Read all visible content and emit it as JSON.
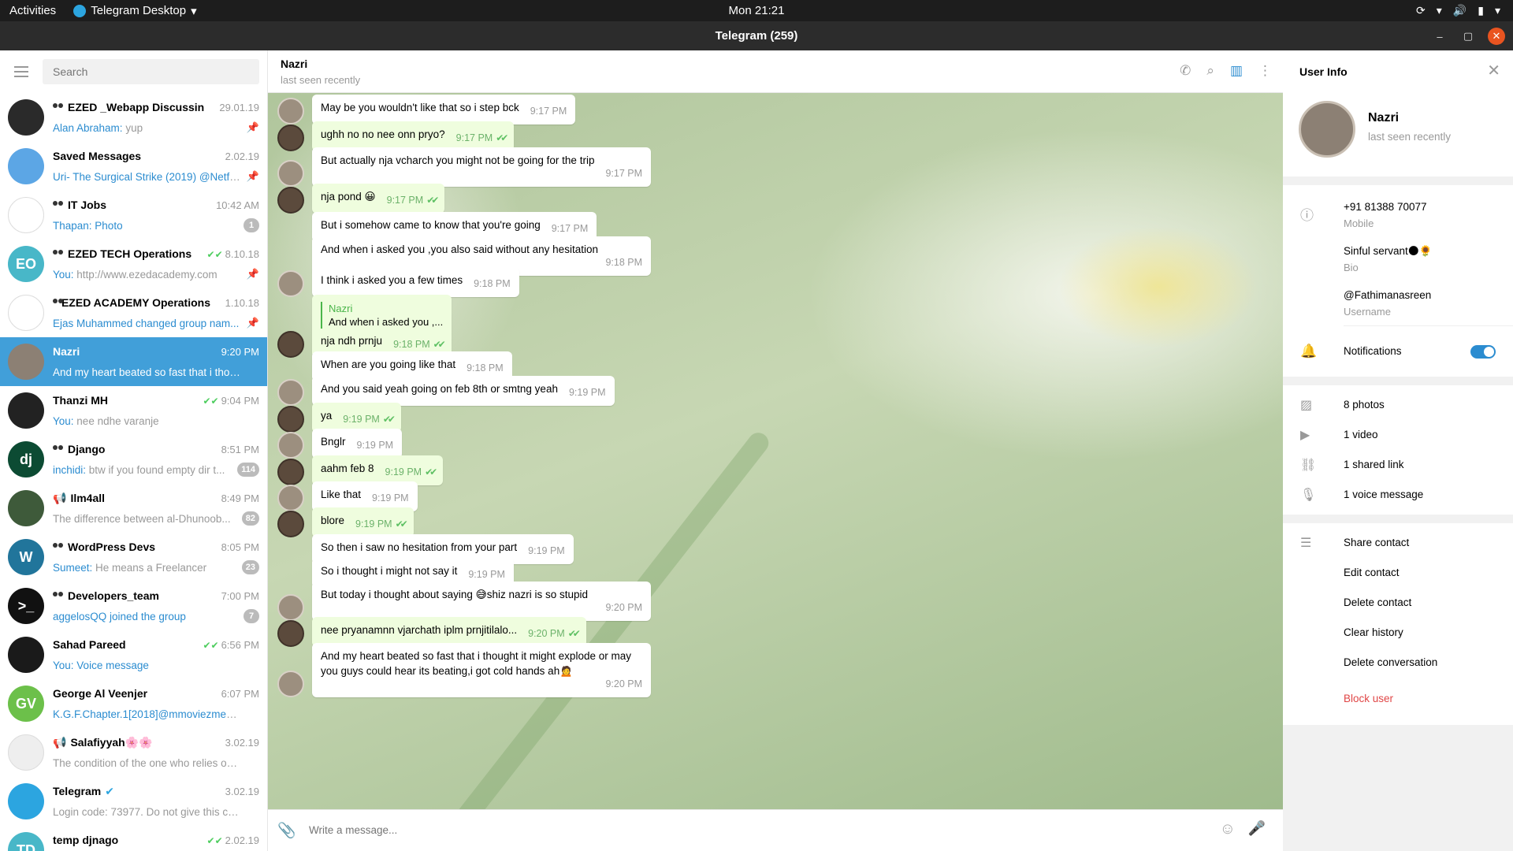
{
  "topbar": {
    "activities": "Activities",
    "app": "Telegram Desktop",
    "clock": "Mon 21:21"
  },
  "window": {
    "title": "Telegram (259)"
  },
  "sidebar": {
    "search_placeholder": "Search",
    "chats": [
      {
        "name": "EZED _Webapp Discussin",
        "time": "29.01.19",
        "sender": "Alan Abraham:",
        "text": " yup",
        "group": true,
        "pinned": true,
        "avatar_color": "#2a2a2a",
        "initials": ""
      },
      {
        "name": "Saved Messages",
        "time": "2.02.19",
        "sender": "",
        "text": "Uri- The Surgical Strike (2019) @Netfli...",
        "highlight_text": true,
        "pinned": true,
        "avatar_color": "#5ca6e5",
        "initials": ""
      },
      {
        "name": "IT Jobs",
        "time": "10:42 AM",
        "sender": "Thapan:",
        "text": " Photo",
        "highlight_text": true,
        "group": true,
        "badge": "1",
        "avatar_color": "#ffffff",
        "initials": ""
      },
      {
        "name": "EZED TECH Operations",
        "time": "8.10.18",
        "sender": "You:",
        "text": " http://www.ezedacademy.com",
        "group": true,
        "pinned": true,
        "check": true,
        "avatar_color": "#48b7c8",
        "initials": "EO"
      },
      {
        "name": "EZED ACADEMY Operations",
        "time": "1.10.18",
        "sender": "Ejas Muhammed changed group nam...",
        "text": "",
        "group": true,
        "pinned": true,
        "avatar_color": "#ffffff",
        "initials": ""
      },
      {
        "name": "Nazri",
        "time": "9:20 PM",
        "sender": "",
        "text": "And my heart beated so fast that i though...",
        "active": true,
        "avatar_color": "#8c8074",
        "initials": ""
      },
      {
        "name": "Thanzi MH",
        "time": "9:04 PM",
        "sender": "You:",
        "text": " nee ndhe varanje",
        "check": true,
        "avatar_color": "#222222",
        "initials": ""
      },
      {
        "name": "Django",
        "time": "8:51 PM",
        "sender": "inchidi:",
        "text": " btw if you found empty dir t...",
        "group": true,
        "badge": "114",
        "avatar_color": "#0c4b33",
        "initials": "dj"
      },
      {
        "name": "Ilm4all",
        "time": "8:49 PM",
        "sender": "",
        "text": "The difference between al-Dhunoob...",
        "channel": true,
        "badge": "82",
        "avatar_color": "#3e5a3a",
        "initials": ""
      },
      {
        "name": "WordPress Devs",
        "time": "8:05 PM",
        "sender": "Sumeet:",
        "text": " He means a Freelancer",
        "group": true,
        "badge": "23",
        "avatar_color": "#21759b",
        "initials": "W"
      },
      {
        "name": "Developers_team",
        "time": "7:00 PM",
        "sender": "aggelosQQ joined the group",
        "text": "",
        "group": true,
        "badge": "7",
        "avatar_color": "#111111",
        "initials": ">_"
      },
      {
        "name": "Sahad Pareed",
        "time": "6:56 PM",
        "sender": "You:",
        "text": " Voice message",
        "highlight_text": true,
        "check": true,
        "avatar_color": "#1a1a1a",
        "initials": ""
      },
      {
        "name": "George Al Veenjer",
        "time": "6:07 PM",
        "sender": "",
        "text": "K.G.F.Chapter.1[2018]@mmoviezmedia.T...",
        "highlight_text": true,
        "avatar_color": "#6cc04a",
        "initials": "GV"
      },
      {
        "name": "Salafiyyah🌸🌸",
        "time": "3.02.19",
        "sender": "",
        "text": "The condition of the one who relies on All...",
        "channel": true,
        "avatar_color": "#eeeeee",
        "initials": ""
      },
      {
        "name": "Telegram",
        "time": "3.02.19",
        "sender": "",
        "text": "Login code: 73977. Do not give this code t...",
        "verified": true,
        "avatar_color": "#2ca5e0",
        "initials": ""
      },
      {
        "name": "temp djnago",
        "time": "2.02.19",
        "sender": "",
        "text": "",
        "check": true,
        "avatar_color": "#48b7c8",
        "initials": "TD"
      }
    ]
  },
  "chat": {
    "name": "Nazri",
    "status": "last seen recently",
    "input_placeholder": "Write a message...",
    "messages": [
      {
        "text": "May be you wouldn't like that so i step bck",
        "time": "9:17 PM",
        "out": false
      },
      {
        "text": "ughh no no nee onn pryo?",
        "time": "9:17 PM",
        "out": true
      },
      {
        "text": "But actually nja vcharch you might not be going for the trip",
        "time": "9:17 PM",
        "out": false,
        "wrap": true
      },
      {
        "text": "nja pond 😀",
        "time": "9:17 PM",
        "out": true
      },
      {
        "text": "But i somehow came to know that you're going",
        "time": "9:17 PM",
        "out": false
      },
      {
        "text": "And when i asked you ,you also said without any hesitation",
        "time": "9:18 PM",
        "out": false,
        "wrap": true
      },
      {
        "text": "I think i asked you a few times",
        "time": "9:18 PM",
        "out": false
      },
      {
        "text": "nja ndh prnju",
        "time": "9:18 PM",
        "out": true,
        "reply_name": "Nazri",
        "reply_text": "And when i asked you ,..."
      },
      {
        "text": "When are you going like that",
        "time": "9:18 PM",
        "out": false
      },
      {
        "text": "And you said yeah going on feb 8th or smtng yeah",
        "time": "9:19 PM",
        "out": false
      },
      {
        "text": "ya",
        "time": "9:19 PM",
        "out": true
      },
      {
        "text": "Bnglr",
        "time": "9:19 PM",
        "out": false
      },
      {
        "text": "aahm feb 8",
        "time": "9:19 PM",
        "out": true
      },
      {
        "text": "Like that",
        "time": "9:19 PM",
        "out": false
      },
      {
        "text": "blore",
        "time": "9:19 PM",
        "out": true
      },
      {
        "text": "So then i saw no hesitation from your part",
        "time": "9:19 PM",
        "out": false
      },
      {
        "text": "So i thought i might not say it",
        "time": "9:19 PM",
        "out": false
      },
      {
        "text": "But today i thought about saying 😅shiz nazri is so stupid",
        "time": "9:20 PM",
        "out": false,
        "wrap": true
      },
      {
        "text": "nee pryanamnn vjarchath iplm prnjitilalo...",
        "time": "9:20 PM",
        "out": true
      },
      {
        "text": "And my heart beated so fast that i thought it might explode or may you guys could hear its beating,i got cold hands ah🙍",
        "time": "9:20 PM",
        "out": false,
        "wrap": true
      }
    ]
  },
  "info": {
    "title": "User Info",
    "name": "Nazri",
    "status": "last seen recently",
    "phone": "+91 81388 70077",
    "phone_label": "Mobile",
    "bio": "Sinful servant🌑🌻",
    "bio_label": "Bio",
    "username": "@Fathimanasreen",
    "username_label": "Username",
    "notifications": "Notifications",
    "notifications_on": true,
    "media": [
      "8 photos",
      "1 video",
      "1 shared link",
      "1 voice message"
    ],
    "actions": [
      "Share contact",
      "Edit contact",
      "Delete contact",
      "Clear history",
      "Delete conversation"
    ],
    "block": "Block user",
    "danger_color": "#e04646"
  }
}
